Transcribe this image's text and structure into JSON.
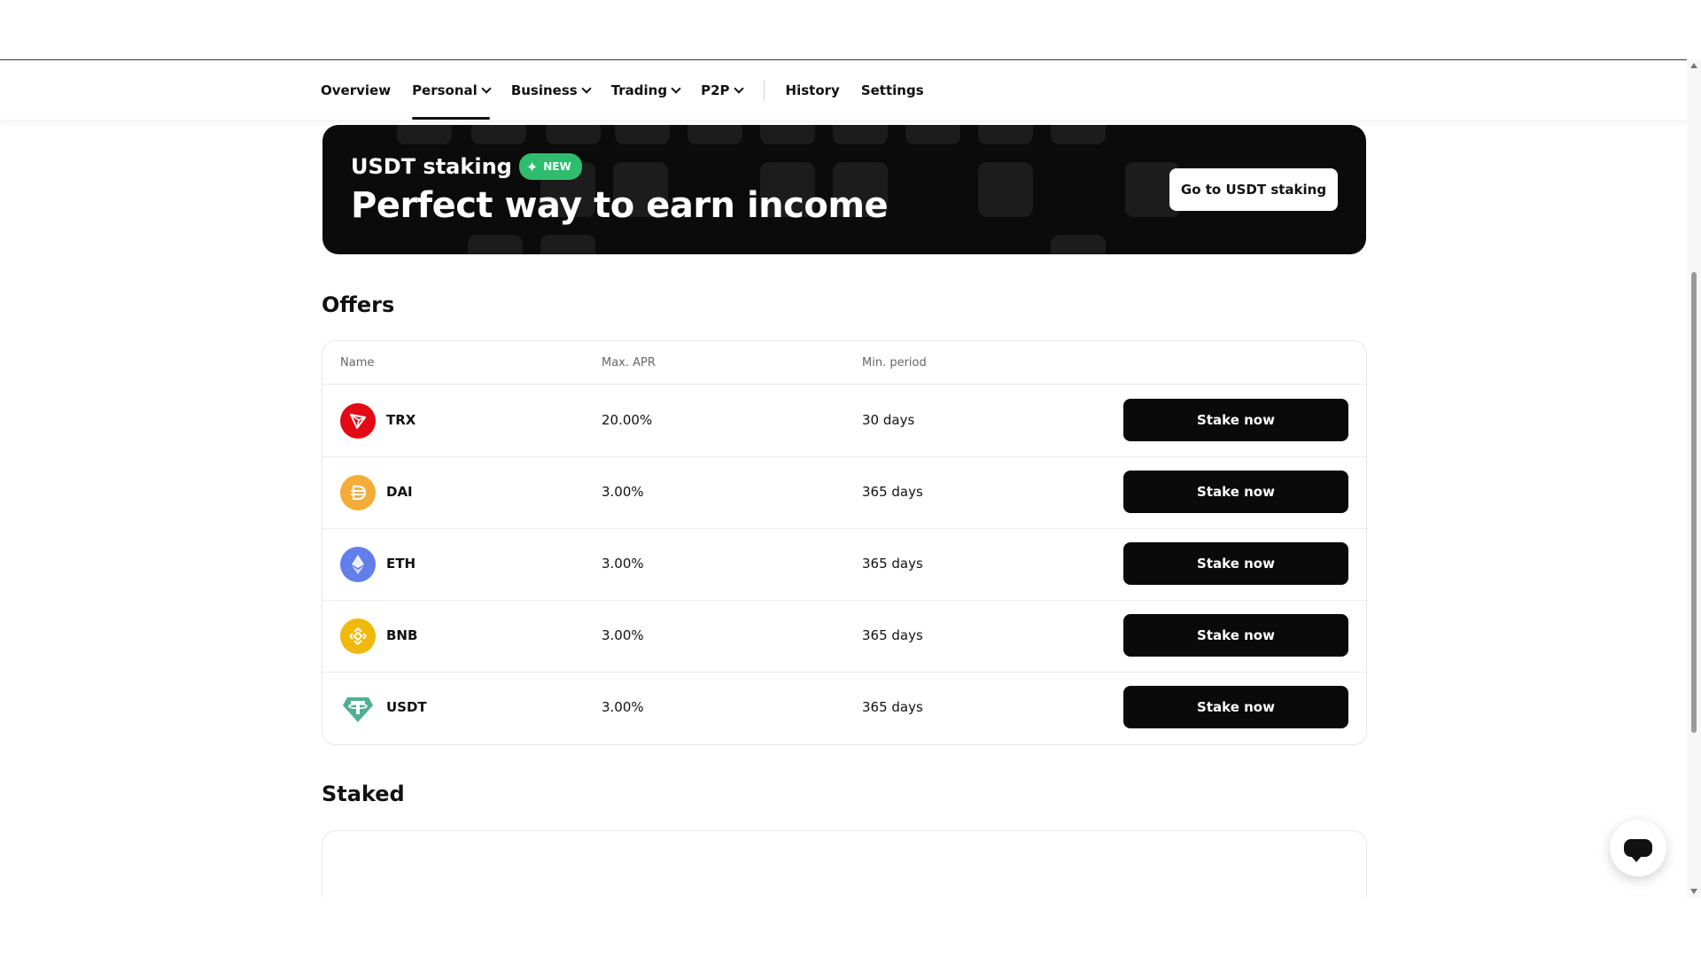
{
  "nav": {
    "items": [
      {
        "label": "Overview",
        "dropdown": false,
        "active": false
      },
      {
        "label": "Personal",
        "dropdown": true,
        "active": true
      },
      {
        "label": "Business",
        "dropdown": true,
        "active": false
      },
      {
        "label": "Trading",
        "dropdown": true,
        "active": false
      },
      {
        "label": "P2P",
        "dropdown": true,
        "active": false
      }
    ],
    "secondary": [
      {
        "label": "History"
      },
      {
        "label": "Settings"
      }
    ]
  },
  "banner": {
    "label": "USDT staking",
    "badge": "NEW",
    "title": "Perfect way to earn income",
    "button": "Go to USDT staking"
  },
  "offers": {
    "title": "Offers",
    "columns": {
      "name": "Name",
      "apr": "Max. APR",
      "period": "Min. period"
    },
    "rows": [
      {
        "name": "TRX",
        "apr": "20.00%",
        "period": "30 days",
        "button": "Stake now",
        "icon": "trx-icon",
        "color": "#e50915"
      },
      {
        "name": "DAI",
        "apr": "3.00%",
        "period": "365 days",
        "button": "Stake now",
        "icon": "dai-icon",
        "color": "#f5ac37"
      },
      {
        "name": "ETH",
        "apr": "3.00%",
        "period": "365 days",
        "button": "Stake now",
        "icon": "eth-icon",
        "color": "#627eea"
      },
      {
        "name": "BNB",
        "apr": "3.00%",
        "period": "365 days",
        "button": "Stake now",
        "icon": "bnb-icon",
        "color": "#f0b90b"
      },
      {
        "name": "USDT",
        "apr": "3.00%",
        "period": "365 days",
        "button": "Stake now",
        "icon": "usdt-icon",
        "color": "#50af95"
      }
    ]
  },
  "staked": {
    "title": "Staked"
  },
  "colors": {
    "accent": "#0a0a0a",
    "badge": "#2ebd6e"
  }
}
